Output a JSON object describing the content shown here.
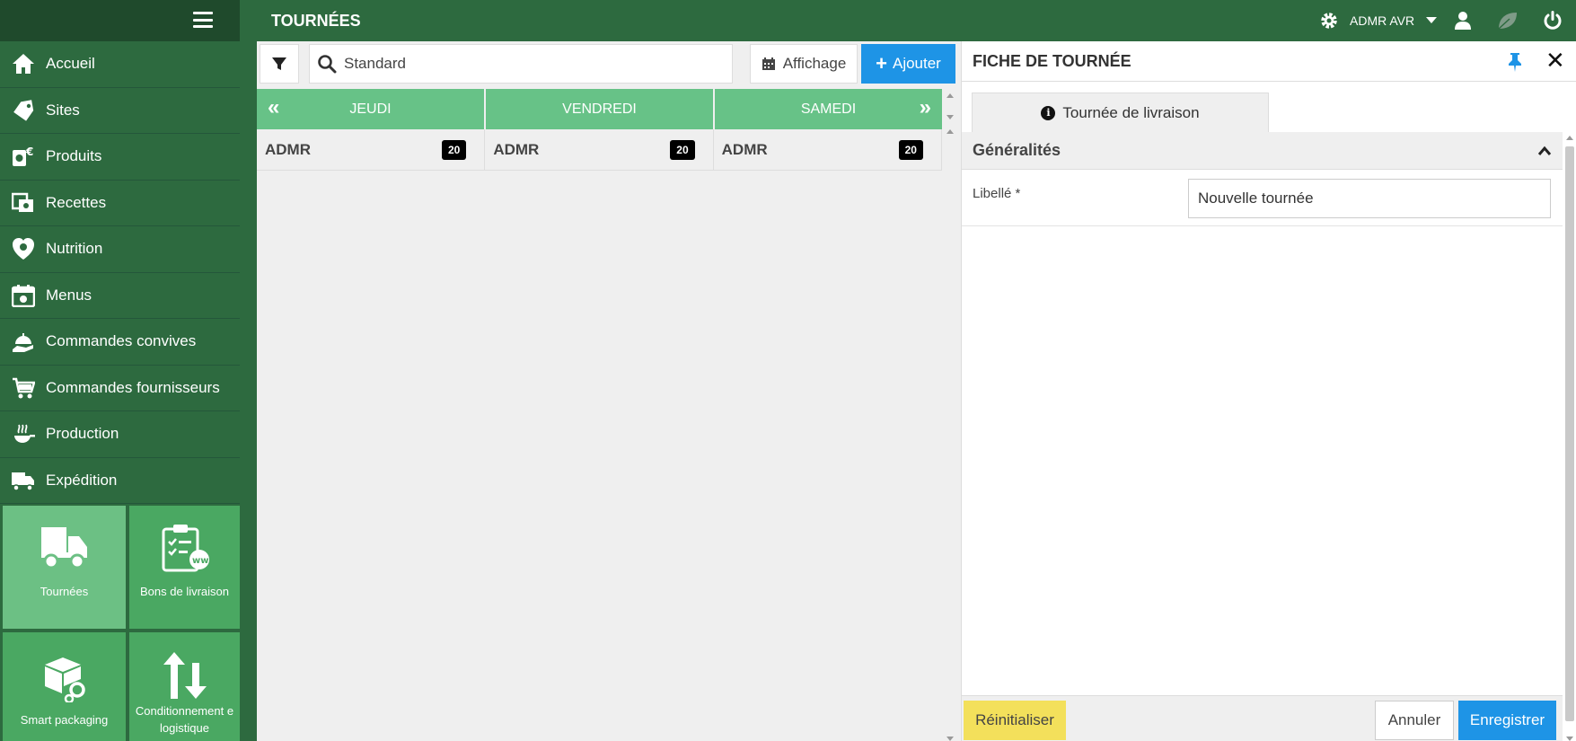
{
  "header": {
    "page_title": "TOURNÉES",
    "user_name": "ADMR AVR"
  },
  "sidebar": {
    "items": [
      {
        "label": "Accueil",
        "icon": "home-icon"
      },
      {
        "label": "Sites",
        "icon": "tag-icon"
      },
      {
        "label": "Produits",
        "icon": "products-icon"
      },
      {
        "label": "Recettes",
        "icon": "recipes-icon"
      },
      {
        "label": "Nutrition",
        "icon": "nutrition-icon"
      },
      {
        "label": "Menus",
        "icon": "calendar-icon"
      },
      {
        "label": "Commandes convives",
        "icon": "serving-icon"
      },
      {
        "label": "Commandes fournisseurs",
        "icon": "cart-icon"
      },
      {
        "label": "Production",
        "icon": "cooking-icon"
      },
      {
        "label": "Expédition",
        "icon": "shipping-icon"
      }
    ],
    "tiles": [
      {
        "label": "Tournées",
        "icon": "truck-icon",
        "active": true
      },
      {
        "label": "Bons de livraison",
        "icon": "clipboard-icon",
        "active": false
      },
      {
        "label": "Smart packaging",
        "icon": "box-gears-icon",
        "active": false
      },
      {
        "label": "Conditionnement e logistique",
        "icon": "up-down-arrows-icon",
        "active": false
      }
    ]
  },
  "toolbar": {
    "search_value": "Standard",
    "affichage_label": "Affichage",
    "ajouter_label": "Ajouter"
  },
  "planning": {
    "days": [
      "JEUDI",
      "VENDREDI",
      "SAMEDI"
    ],
    "rows": [
      {
        "name": "ADMR",
        "count": "20"
      },
      {
        "name": "ADMR",
        "count": "20"
      },
      {
        "name": "ADMR",
        "count": "20"
      }
    ]
  },
  "fiche": {
    "title": "FICHE DE TOURNÉE",
    "tab_label": "Tournée de livraison",
    "section_title": "Généralités",
    "field_label": "Libellé *",
    "field_value": "Nouvelle tournée",
    "reset_label": "Réinitialiser",
    "cancel_label": "Annuler",
    "save_label": "Enregistrer"
  },
  "colors": {
    "brand_dark": "#1f4a2c",
    "brand": "#2d6a3f",
    "tile": "#4aa862",
    "tile_active": "#6cc084",
    "day_header": "#67c287",
    "primary": "#1e94e6",
    "warning": "#f3e05b"
  }
}
